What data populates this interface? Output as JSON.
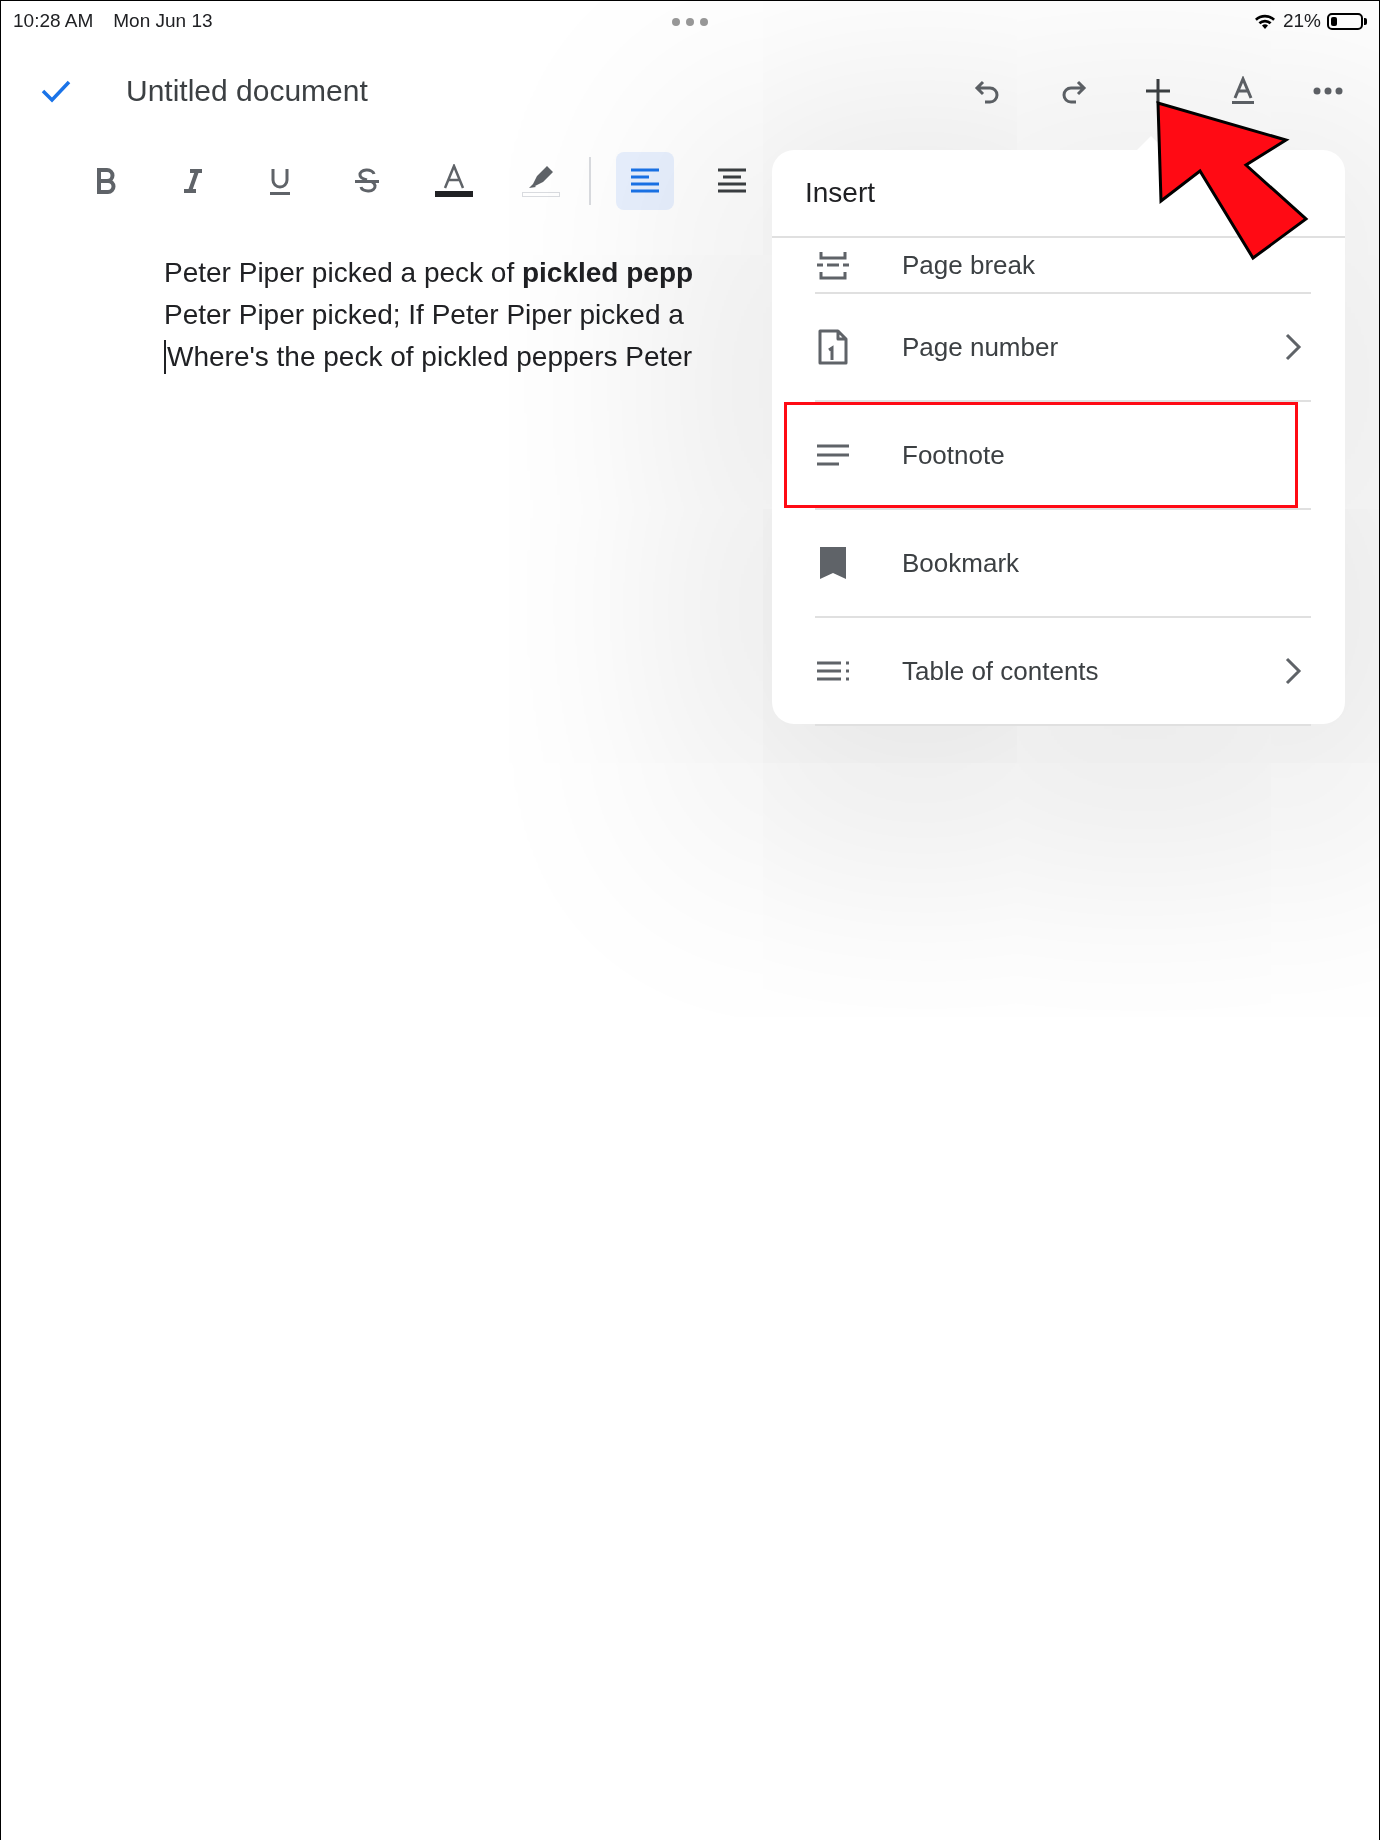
{
  "status_bar": {
    "time": "10:28 AM",
    "date": "Mon Jun 13",
    "battery_percent": "21%"
  },
  "title_bar": {
    "title": "Untitled document",
    "actions": [
      {
        "kind": "undo"
      },
      {
        "kind": "redo"
      },
      {
        "kind": "insert"
      },
      {
        "kind": "text_format"
      },
      {
        "kind": "more"
      }
    ]
  },
  "format_toolbar": [
    {
      "kind": "bold",
      "selected": false
    },
    {
      "kind": "italic",
      "selected": false
    },
    {
      "kind": "underline",
      "selected": false
    },
    {
      "kind": "strikethrough",
      "selected": false
    },
    {
      "kind": "text_color",
      "selected": false
    },
    {
      "kind": "highlight",
      "selected": false
    },
    {
      "kind": "align_left",
      "selected": true
    },
    {
      "kind": "align_center",
      "selected": false
    }
  ],
  "document": {
    "lines": [
      {
        "text": "Peter Piper picked a peck of **pickled pepp**",
        "cursor": false
      },
      {
        "text": "Peter Piper picked; If Peter Piper picked a",
        "cursor": false
      },
      {
        "text": "Where's the peck of pickled peppers Peter",
        "cursor": true
      }
    ]
  },
  "insert_menu": {
    "title": "Insert",
    "items": [
      {
        "label": "Page break",
        "kind": "page_break",
        "submenu": false,
        "highlighted": false
      },
      {
        "label": "Page number",
        "kind": "page_number",
        "submenu": true,
        "highlighted": false
      },
      {
        "label": "Footnote",
        "kind": "footnote",
        "submenu": false,
        "highlighted": true
      },
      {
        "label": "Bookmark",
        "kind": "bookmark",
        "submenu": false,
        "highlighted": false
      },
      {
        "label": "Table of contents",
        "kind": "table_of_contents",
        "submenu": true,
        "highlighted": false
      }
    ]
  },
  "annotation": {
    "arrow": true
  }
}
